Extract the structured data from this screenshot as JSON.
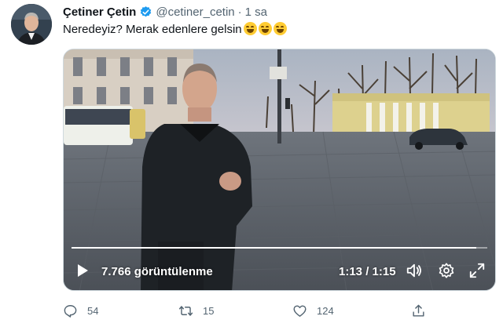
{
  "tweet": {
    "author_name": "Çetiner Çetin",
    "handle": "@cetiner_cetin",
    "separator": "·",
    "time": "1 sa",
    "text": "Neredeyiz? Merak edenlere gelsin",
    "emoji": [
      "face-with-tears-of-joy",
      "face-with-tears-of-joy",
      "face-with-tears-of-joy"
    ]
  },
  "video": {
    "views_label": "7.766 görüntülenme",
    "timecode": "1:13 / 1:15",
    "progress_fraction": 0.973,
    "icons": [
      "play-icon",
      "volume-icon",
      "settings-icon",
      "fullscreen-icon"
    ]
  },
  "actions": {
    "reply_count": "54",
    "retweet_count": "15",
    "like_count": "124"
  },
  "colors": {
    "verified": "#1d9bf0",
    "secondary_text": "#536471",
    "primary_text": "#0f1419"
  }
}
